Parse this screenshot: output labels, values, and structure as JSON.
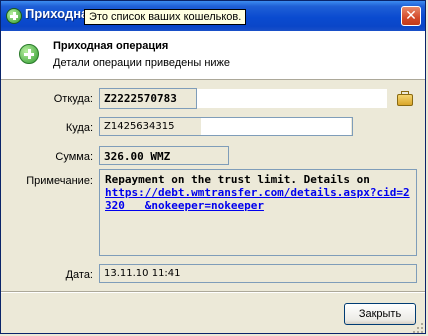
{
  "window": {
    "title": "Приходна"
  },
  "tooltip": {
    "text": "Это список ваших кошельков."
  },
  "header": {
    "title": "Приходная операция",
    "subtitle": "Детали операции приведены ниже"
  },
  "form": {
    "from_label": "Откуда:",
    "from_value": "Z2222570783",
    "to_label": "Куда:",
    "to_value": "Z1425634315",
    "amount_label": "Сумма:",
    "amount_value": "326.00 WMZ",
    "note_label": "Примечание:",
    "note_text": "Repayment on the trust limit. Details on",
    "note_link": "https://debt.wmtransfer.com/details.aspx?cid=2320   &nokeeper=nokeeper",
    "date_label": "Дата:",
    "date_value": "13.11.10 11:41"
  },
  "buttons": {
    "close_label": "Закрыть"
  },
  "icons": {
    "app": "plus-circle-icon",
    "header": "plus-circle-icon",
    "wallet": "wallet-icon",
    "close": "close-icon"
  },
  "colors": {
    "titlebar": "#0a46c8",
    "link": "#0000ee",
    "close_red": "#d34a2a",
    "window_bg": "#ece9d8"
  }
}
